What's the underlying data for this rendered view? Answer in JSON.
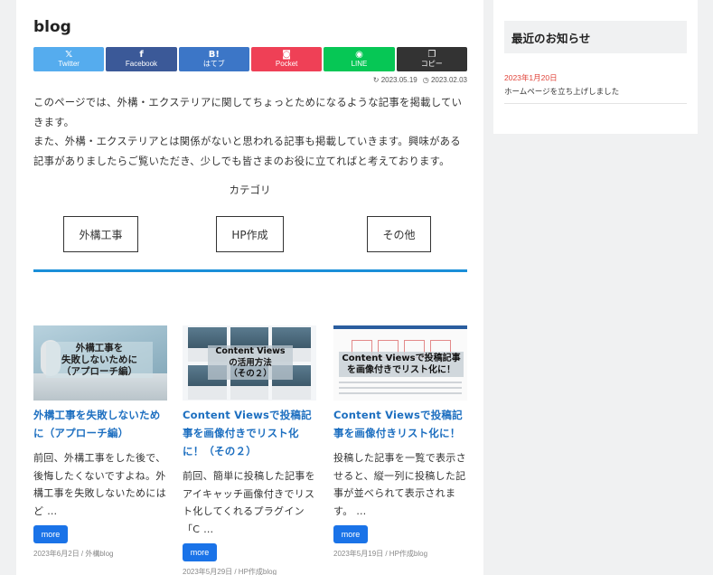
{
  "page": {
    "title": "blog",
    "share": [
      {
        "icon": "𝕏",
        "label": "Twitter"
      },
      {
        "icon": "f",
        "label": "Facebook"
      },
      {
        "icon": "B!",
        "label": "はてブ"
      },
      {
        "icon": "◙",
        "label": "Pocket"
      },
      {
        "icon": "◉",
        "label": "LINE"
      },
      {
        "icon": "❐",
        "label": "コピー"
      }
    ],
    "updated": "2023.05.19",
    "published": "2023.02.03",
    "intro": [
      "このページでは、外構・エクステリアに関してちょっとためになるような記事を掲載していきます。",
      "また、外構・エクステリアとは関係がないと思われる記事も掲載していきます。興味がある記事がありましたらご覧いただき、少しでも皆さまのお役に立てればと考えております。"
    ],
    "category_heading": "カテゴリ",
    "categories": [
      "外構工事",
      "HP作成",
      "その他"
    ]
  },
  "posts": [
    {
      "thumb_text": "外構工事を\n失敗しないために\n（アプローチ編）",
      "title": "外構工事を失敗しないために（アプローチ編）",
      "excerpt": "前回、外構工事をした後で、後悔したくないですよね。外構工事を失敗しないためにはど …",
      "more": "more",
      "meta": "2023年6月2日 / 外構blog"
    },
    {
      "thumb_text": "Content Views\nの活用方法\n（その２）",
      "title": "Content Viewsで投稿記事を画像付きでリスト化に！（その２）",
      "excerpt": "前回、簡単に投稿した記事をアイキャッチ画像付きでリスト化してくれるプラグイン「C …",
      "more": "more",
      "meta": "2023年5月29日 / HP作成blog"
    },
    {
      "thumb_text": "Content Viewsで投稿記事\nを画像付きでリスト化に！",
      "title": "Content Viewsで投稿記事を画像付きリスト化に！",
      "excerpt": "投稿した記事を一覧で表示させると、縦一列に投稿した記事が並べられて表示されます。 …",
      "more": "more",
      "meta": "2023年5月19日 / HP作成blog"
    }
  ],
  "sidebar": {
    "heading": "最近のお知らせ",
    "news": [
      {
        "date": "2023年1月20日",
        "text": "ホームページを立ち上げしました"
      }
    ]
  },
  "colors": {
    "accent": "#1a73e8",
    "link": "#1d6fc0",
    "divider": "#1a8fd8",
    "news_date": "#e0443a"
  }
}
